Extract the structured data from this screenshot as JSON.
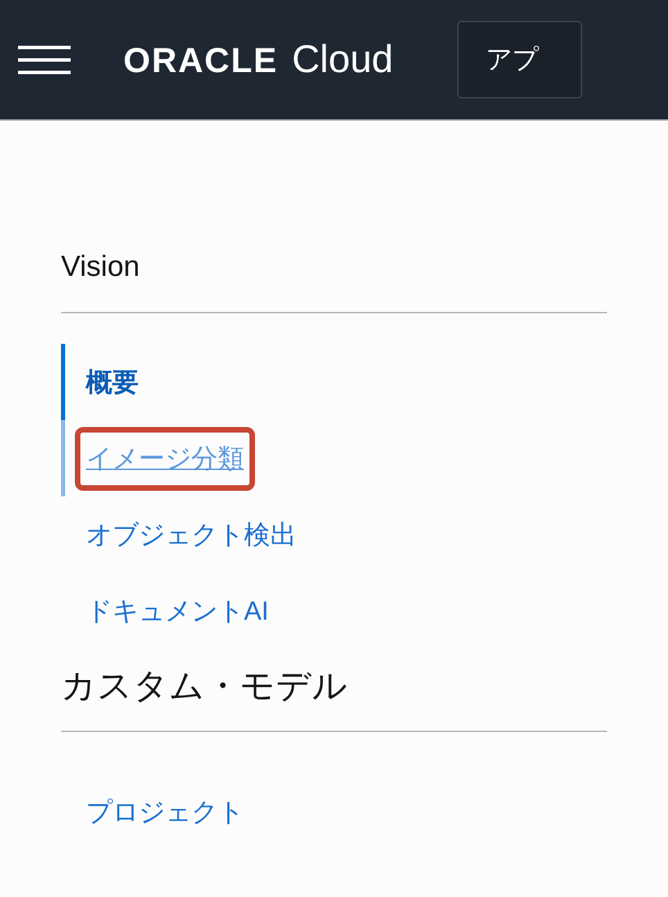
{
  "header": {
    "logo": {
      "brand": "ORACLE",
      "product": "Cloud"
    },
    "button": "アプ"
  },
  "sections": [
    {
      "title": "Vision",
      "items": [
        {
          "label": "概要",
          "selected": true,
          "hovered": false,
          "highlighted": false
        },
        {
          "label": "イメージ分類",
          "selected": false,
          "hovered": true,
          "highlighted": true
        },
        {
          "label": "オブジェクト検出",
          "selected": false,
          "hovered": false,
          "highlighted": false
        },
        {
          "label": "ドキュメントAI",
          "selected": false,
          "hovered": false,
          "highlighted": false
        }
      ]
    },
    {
      "title": "カスタム・モデル",
      "items": [
        {
          "label": "プロジェクト",
          "selected": false,
          "hovered": false,
          "highlighted": false
        }
      ]
    }
  ]
}
